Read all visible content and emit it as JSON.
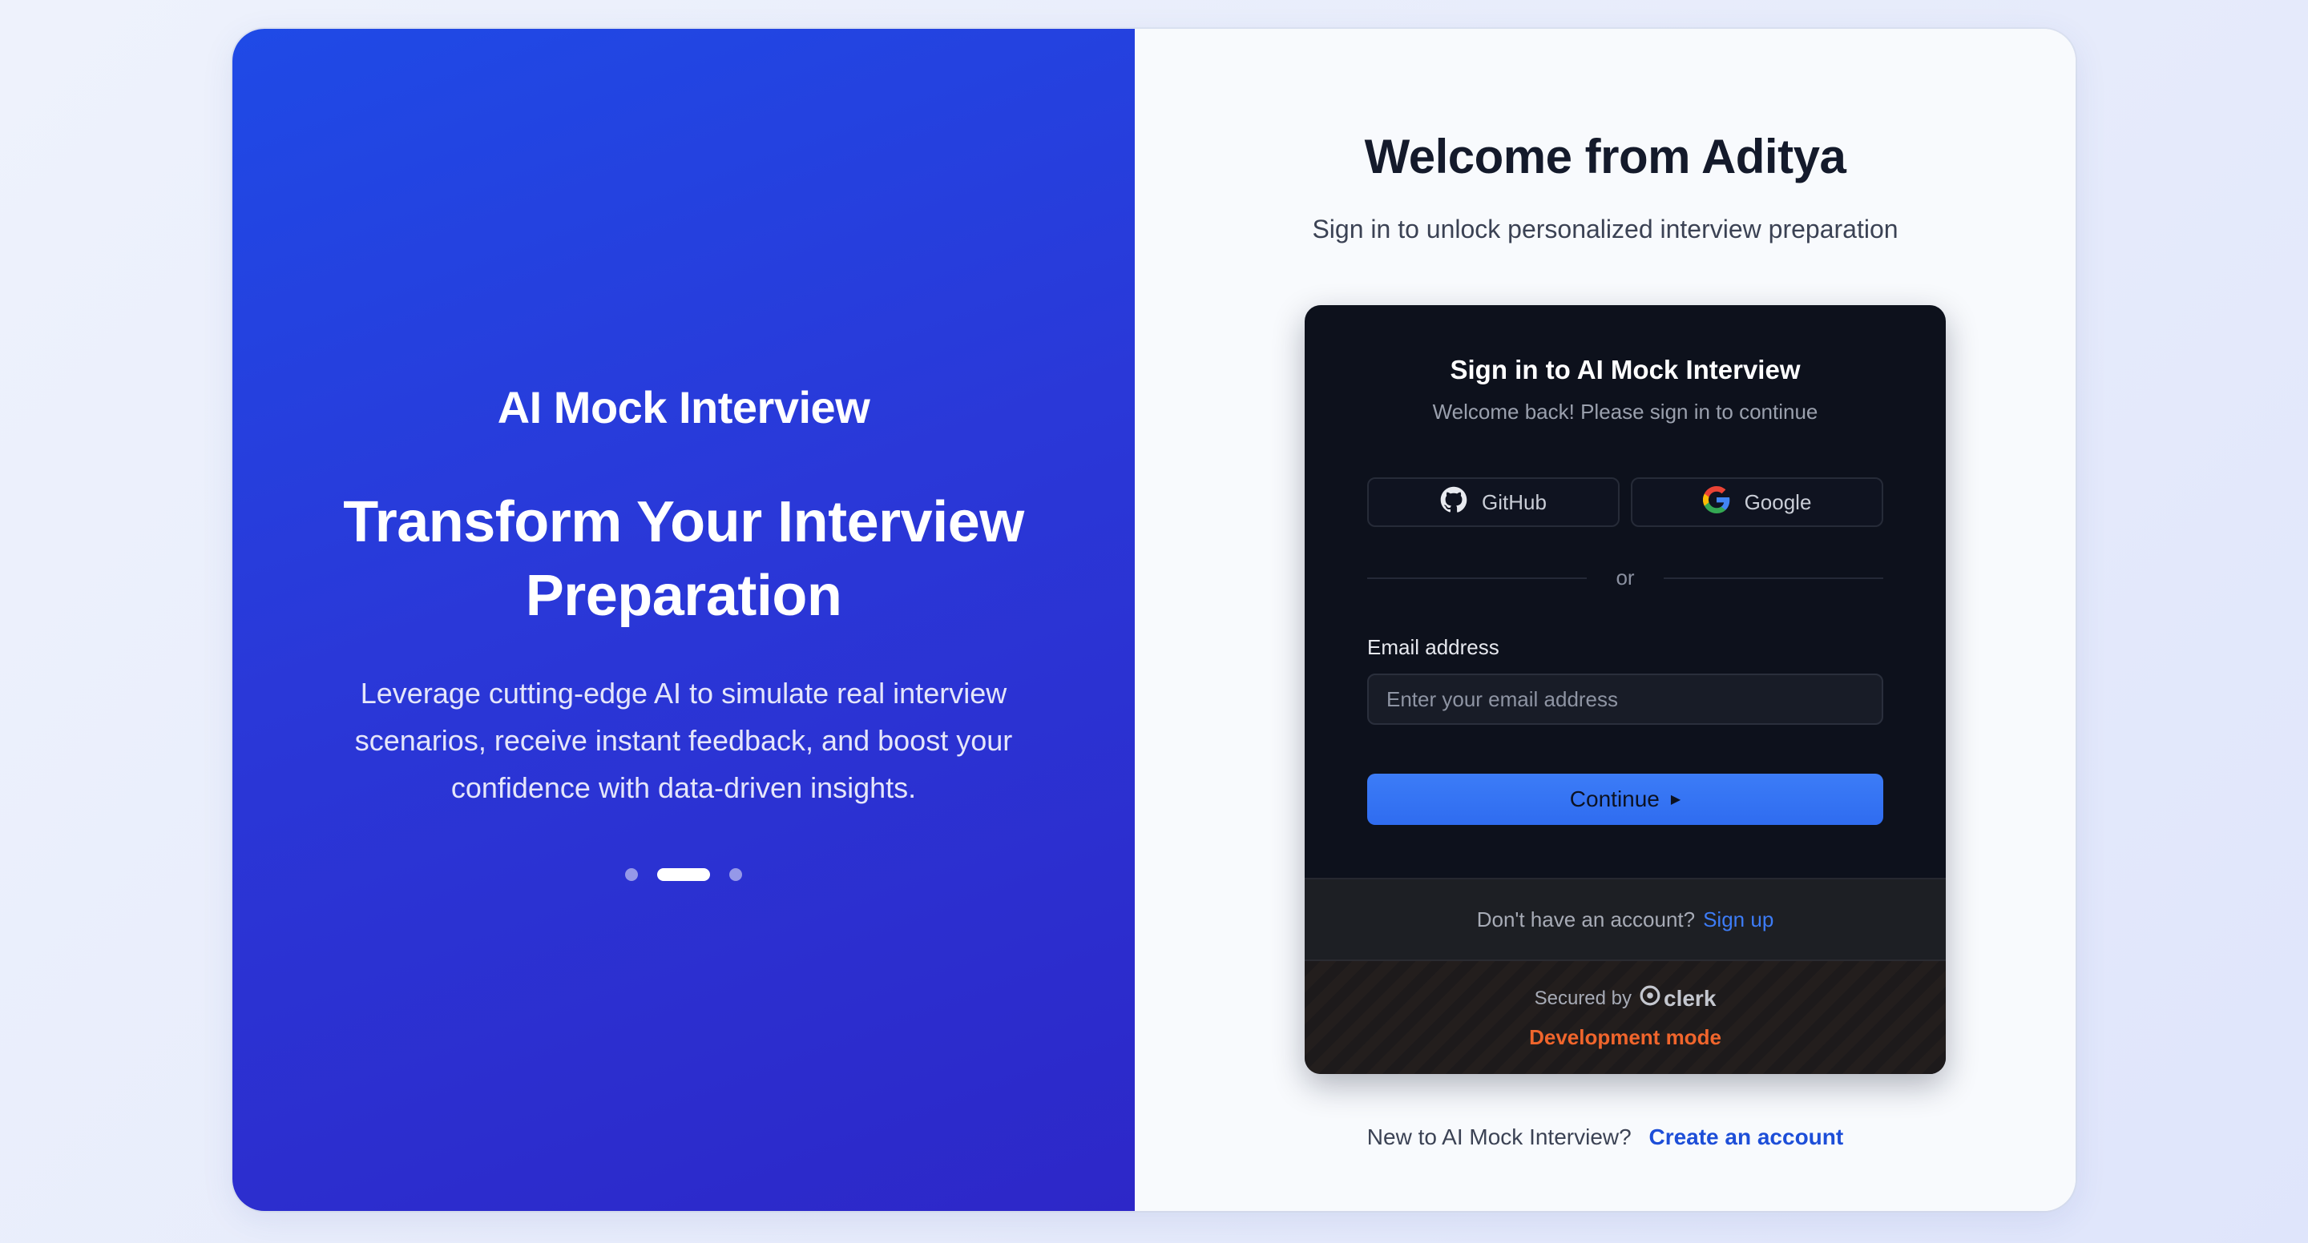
{
  "hero": {
    "brand": "AI Mock Interview",
    "headline_line1": "Transform Your Interview",
    "headline_line2": "Preparation",
    "description": "Leverage cutting-edge AI to simulate real interview scenarios, receive instant feedback, and boost your confidence with data-driven insights.",
    "carousel": {
      "total": 3,
      "active": 2
    }
  },
  "panel": {
    "title": "Welcome from Aditya",
    "subtitle": "Sign in to unlock personalized interview preparation",
    "bottom_text": "New to AI Mock Interview?",
    "bottom_link": "Create an account"
  },
  "signin": {
    "title": "Sign in to AI Mock Interview",
    "subtitle": "Welcome back! Please sign in to continue",
    "github_label": "GitHub",
    "google_label": "Google",
    "divider": "or",
    "email_label": "Email address",
    "email_placeholder": "Enter your email address",
    "email_value": "",
    "continue_label": "Continue",
    "no_account_text": "Don't have an account?",
    "signup_link": "Sign up",
    "secured_by": "Secured by",
    "clerk_brand": "clerk",
    "dev_mode": "Development mode"
  },
  "icons": {
    "github": "github-icon",
    "google": "google-icon",
    "continue_arrow": "play-arrow-icon",
    "clerk_logo": "clerk-logo-icon"
  },
  "colors": {
    "hero_gradient_start": "#1f4ae6",
    "hero_gradient_end": "#2d27c8",
    "primary_button": "#3c7cf7",
    "link_blue": "#1d4ed8",
    "dev_mode_orange": "#f0652c",
    "card_bg": "#0d111c"
  }
}
